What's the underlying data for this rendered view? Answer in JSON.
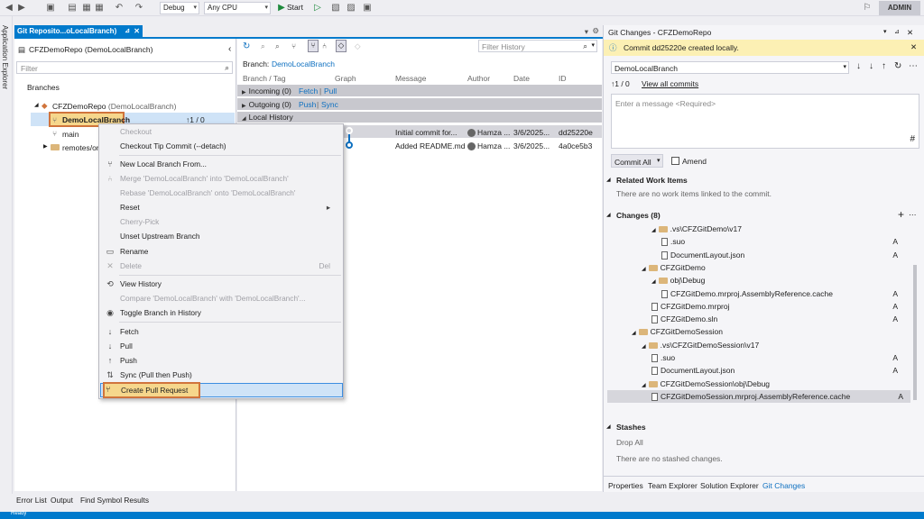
{
  "toolbar": {
    "config": "Debug",
    "platform": "Any CPU",
    "start": "Start",
    "user": "ADMIN"
  },
  "side": {
    "app_explorer": "Application Explorer"
  },
  "doc_tab": {
    "title": "Git Reposito...oLocalBranch)"
  },
  "left": {
    "repo_title": "CFZDemoRepo (DemoLocalBranch)",
    "filter_placeholder": "Filter",
    "branches_label": "Branches",
    "repo_node": "CFZDemoRepo",
    "repo_node_branch": "(DemoLocalBranch)",
    "current_branch": "DemoLocalBranch",
    "current_branch_counts": "↑1 / 0",
    "main_branch": "main",
    "remotes": "remotes/ori"
  },
  "menu": {
    "items": [
      {
        "label": "Checkout",
        "disabled": true,
        "icon": ""
      },
      {
        "label": "Checkout Tip Commit (--detach)",
        "disabled": false,
        "icon": ""
      },
      {
        "label": "New Local Branch From...",
        "disabled": false,
        "icon": "branch-icon"
      },
      {
        "label": "Merge 'DemoLocalBranch' into 'DemoLocalBranch'",
        "disabled": true,
        "icon": "merge-icon"
      },
      {
        "label": "Rebase 'DemoLocalBranch' onto 'DemoLocalBranch'",
        "disabled": true,
        "icon": ""
      },
      {
        "label": "Reset",
        "disabled": false,
        "icon": "",
        "submenu": "▸"
      },
      {
        "label": "Cherry-Pick",
        "disabled": true,
        "icon": ""
      },
      {
        "label": "Unset Upstream Branch",
        "disabled": false,
        "icon": ""
      },
      {
        "label": "Rename",
        "disabled": false,
        "icon": "rename-icon"
      },
      {
        "label": "Delete",
        "disabled": true,
        "icon": "delete-icon",
        "shortcut": "Del"
      },
      {
        "label": "View History",
        "disabled": false,
        "icon": "history-icon"
      },
      {
        "label": "Compare 'DemoLocalBranch' with 'DemoLocalBranch'...",
        "disabled": true,
        "icon": ""
      },
      {
        "label": "Toggle Branch in History",
        "disabled": false,
        "icon": "eye-icon"
      },
      {
        "label": "Fetch",
        "disabled": false,
        "icon": "fetch-icon"
      },
      {
        "label": "Pull",
        "disabled": false,
        "icon": "pull-icon"
      },
      {
        "label": "Push",
        "disabled": false,
        "icon": "push-icon"
      },
      {
        "label": "Sync (Pull then Push)",
        "disabled": false,
        "icon": "sync-icon"
      },
      {
        "label": "Create Pull Request",
        "disabled": false,
        "icon": "pull-request-icon"
      }
    ]
  },
  "history": {
    "filter_placeholder": "Filter History",
    "branch_label": "Branch:",
    "branch_value": "DemoLocalBranch",
    "columns": [
      "Branch / Tag",
      "Graph",
      "Message",
      "Author",
      "Date",
      "ID"
    ],
    "incoming": "Incoming (0)",
    "fetch": "Fetch",
    "pull": "Pull",
    "outgoing": "Outgoing (0)",
    "push": "Push",
    "sync": "Sync",
    "local_history": "Local History",
    "commits": [
      {
        "message": "Initial commit for...",
        "author": "Hamza ...",
        "date": "3/6/2025...",
        "id": "dd25220e"
      },
      {
        "message": "Added README.md",
        "author": "Hamza ...",
        "date": "3/6/2025...",
        "id": "4a0ce5b3"
      }
    ]
  },
  "git_changes": {
    "title": "Git Changes - CFZDemoRepo",
    "info": "Commit dd25220e created locally.",
    "branch": "DemoLocalBranch",
    "counts": "↑1 / 0",
    "view_all": "View all commits",
    "message_placeholder": "Enter a message <Required>",
    "commit_all": "Commit All",
    "amend": "Amend",
    "related_work_items": "Related Work Items",
    "no_work_items": "There are no work items linked to the commit.",
    "changes_header": "Changes (8)",
    "changes": [
      {
        "indent": 1,
        "type": "folder",
        "name": ".vs\\CFZGitDemo\\v17",
        "status": ""
      },
      {
        "indent": 2,
        "type": "file",
        "name": ".suo",
        "status": "A"
      },
      {
        "indent": 2,
        "type": "file",
        "name": "DocumentLayout.json",
        "status": "A"
      },
      {
        "indent": 0,
        "type": "folder",
        "name": "CFZGitDemo",
        "status": ""
      },
      {
        "indent": 1,
        "type": "folder",
        "name": "obj\\Debug",
        "status": ""
      },
      {
        "indent": 2,
        "type": "file",
        "name": "CFZGitDemo.mrproj.AssemblyReference.cache",
        "status": "A"
      },
      {
        "indent": 1,
        "type": "file",
        "name": "CFZGitDemo.mrproj",
        "status": "A"
      },
      {
        "indent": 1,
        "type": "file",
        "name": "CFZGitDemo.sln",
        "status": "A"
      },
      {
        "indent": -1,
        "type": "folder",
        "name": "CFZGitDemoSession",
        "status": ""
      },
      {
        "indent": 0,
        "type": "folder",
        "name": ".vs\\CFZGitDemoSession\\v17",
        "status": ""
      },
      {
        "indent": 1,
        "type": "file",
        "name": ".suo",
        "status": "A"
      },
      {
        "indent": 1,
        "type": "file",
        "name": "DocumentLayout.json",
        "status": "A"
      },
      {
        "indent": 0,
        "type": "folder",
        "name": "CFZGitDemoSession\\obj\\Debug",
        "status": ""
      },
      {
        "indent": 1,
        "type": "file",
        "name": "CFZGitDemoSession.mrproj.AssemblyReference.cache",
        "status": "A"
      }
    ],
    "stashes": "Stashes",
    "drop_all": "Drop All",
    "no_stashes": "There are no stashed changes.",
    "tabs": [
      "Properties",
      "Team Explorer",
      "Solution Explorer",
      "Git Changes"
    ]
  },
  "bottom_tabs": [
    "Error List",
    "Output",
    "Find Symbol Results"
  ],
  "status": {
    "ready": "Ready"
  },
  "colors": {
    "accent": "#007acc",
    "highlight": "#f6d78c",
    "orange_border": "#d0743c"
  }
}
